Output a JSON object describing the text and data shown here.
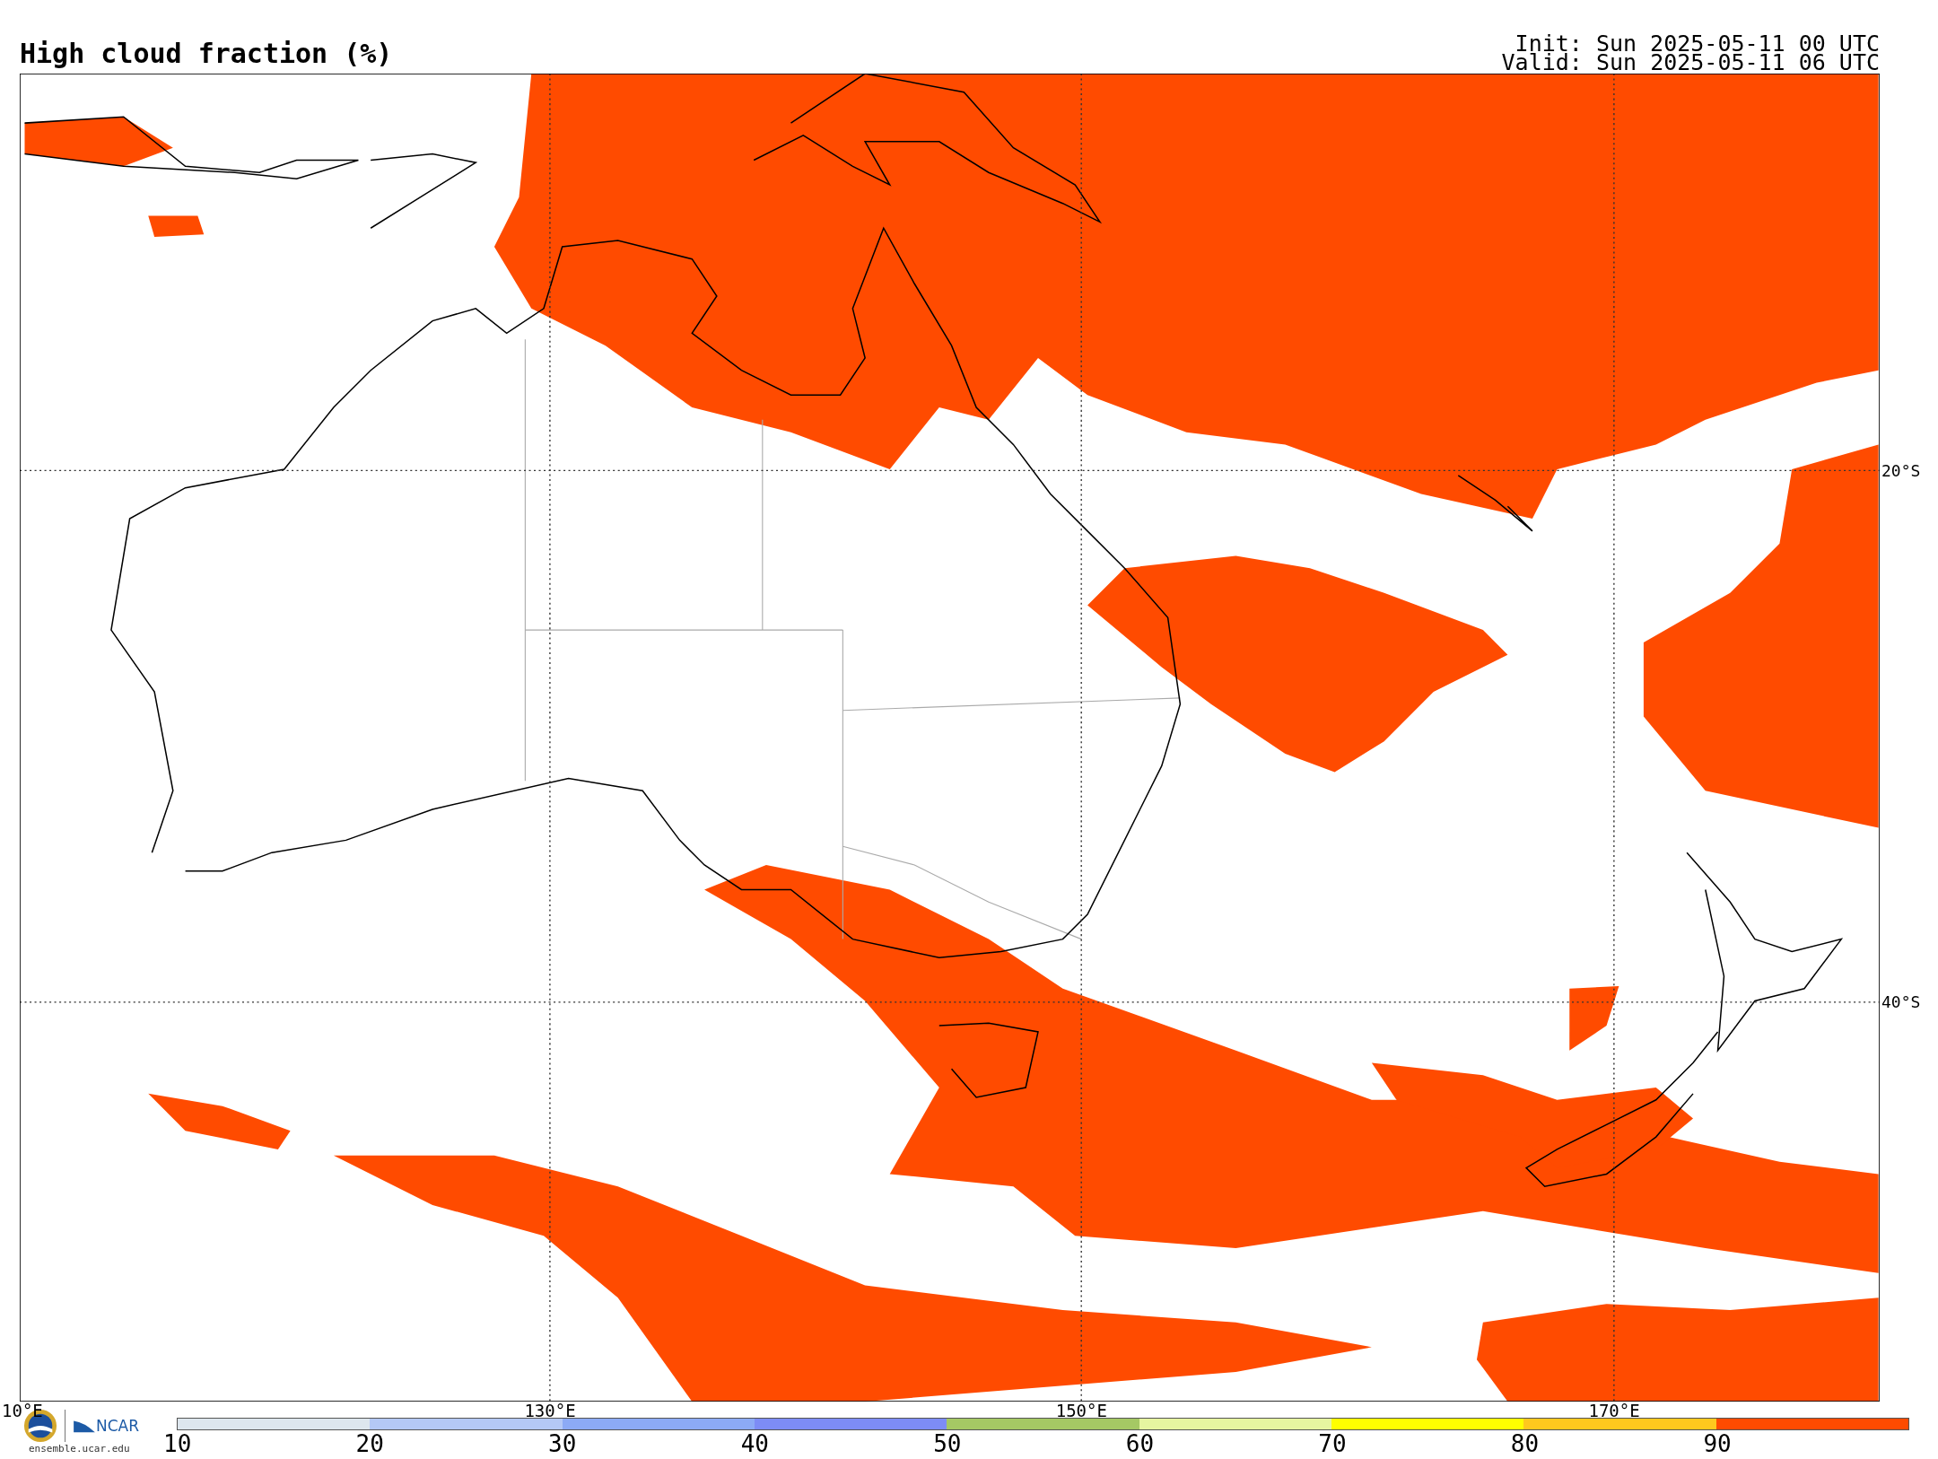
{
  "title": "High cloud fraction (%)",
  "init": "Init: Sun 2025-05-11 00 UTC",
  "valid": "Valid: Sun 2025-05-11 06 UTC",
  "map": {
    "lat_labels": [
      "20°S",
      "40°S"
    ],
    "lon_labels": [
      "10°E",
      "130°E",
      "150°E",
      "170°E"
    ]
  },
  "logo": {
    "org": "NCAR",
    "url": "ensemble.ucar.edu"
  },
  "colorbar": {
    "segments": [
      {
        "color": "#dde6ee"
      },
      {
        "color": "#b4c8f5"
      },
      {
        "color": "#8caaf5"
      },
      {
        "color": "#7d8cf5"
      },
      {
        "color": "#a5c864"
      },
      {
        "color": "#e6f5a0"
      },
      {
        "color": "#ffff00"
      },
      {
        "color": "#ffc81e"
      },
      {
        "color": "#ff4b00"
      }
    ],
    "ticks": [
      "10",
      "20",
      "30",
      "40",
      "50",
      "60",
      "70",
      "80",
      "90"
    ]
  }
}
